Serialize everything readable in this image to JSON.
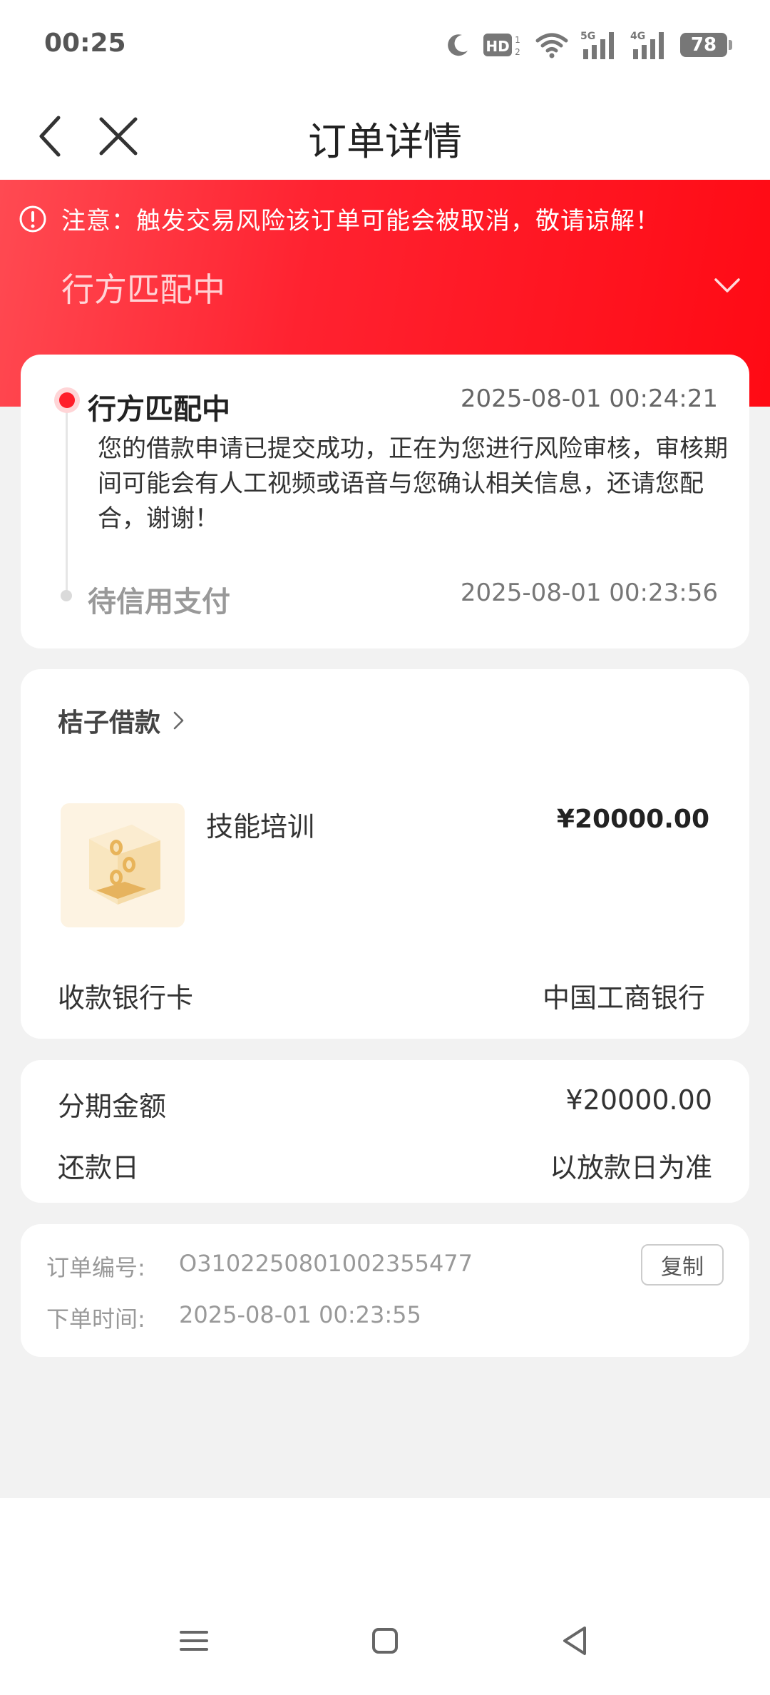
{
  "status_bar": {
    "time": "00:25",
    "battery": "78",
    "hd_label": "HD",
    "signal_5g": "5G",
    "signal_4g": "4G"
  },
  "nav": {
    "title": "订单详情"
  },
  "header": {
    "warning": "注意：触发交易风险该订单可能会被取消，敬请谅解！",
    "status": "行方匹配中"
  },
  "timeline": {
    "steps": [
      {
        "title": "行方匹配中",
        "time": "2025-08-01 00:24:21",
        "desc": "您的借款申请已提交成功，正在为您进行风险审核，审核期间可能会有人工视频或语音与您确认相关信息，还请您配合，谢谢！"
      },
      {
        "title": "待信用支付",
        "time": "2025-08-01 00:23:56"
      }
    ]
  },
  "loan": {
    "lender": "桔子借款",
    "product": "技能培训",
    "amount": "¥20000.00",
    "bank_label": "收款银行卡",
    "bank_value": "中国工商银行"
  },
  "installment": {
    "amount_label": "分期金额",
    "amount_value": "¥20000.00",
    "repay_label": "还款日",
    "repay_value": "以放款日为准"
  },
  "order": {
    "number_label": "订单编号:",
    "number_value": "O3102250801002355477",
    "time_label": "下单时间:",
    "time_value": "2025-08-01 00:23:55",
    "copy_label": "复制"
  },
  "colors": {
    "accent_red": "#ff1e2a",
    "background_gray": "#f2f2f2"
  }
}
